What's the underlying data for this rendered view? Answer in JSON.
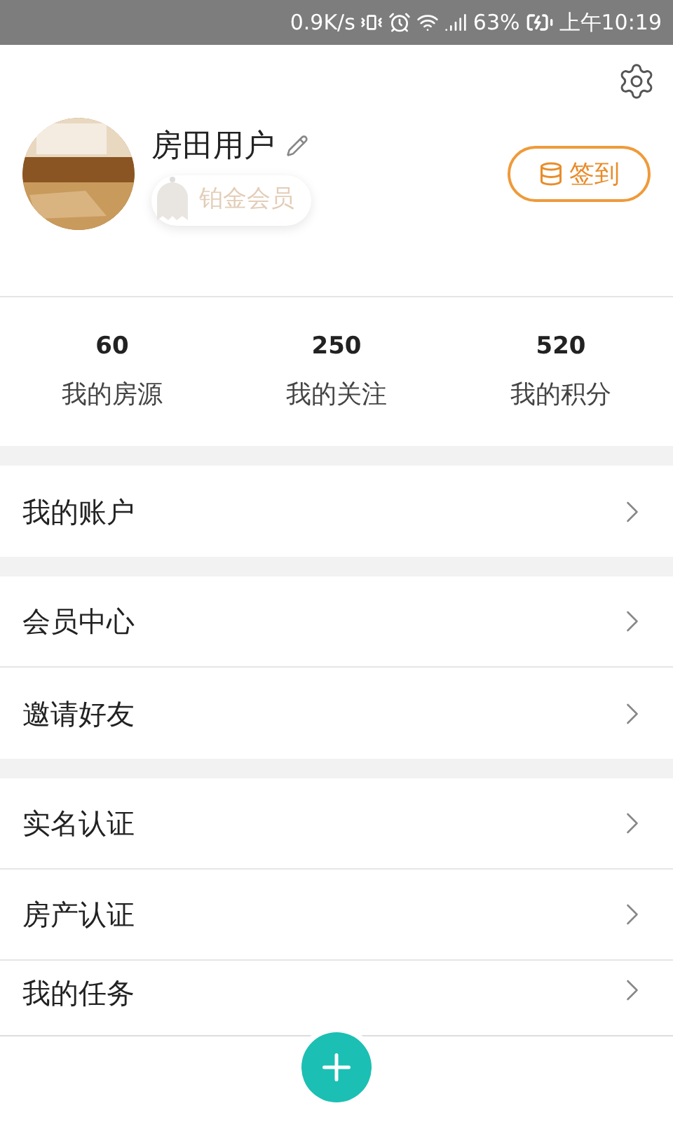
{
  "status_bar": {
    "speed": "0.9K/s",
    "battery": "63%",
    "time": "上午10:19"
  },
  "profile": {
    "name": "房田用户",
    "badge": "铂金会员",
    "checkin": "签到"
  },
  "stats": [
    {
      "value": "60",
      "label": "我的房源"
    },
    {
      "value": "250",
      "label": "我的关注"
    },
    {
      "value": "520",
      "label": "我的积分"
    }
  ],
  "menu_groups": [
    [
      "我的账户"
    ],
    [
      "会员中心",
      "邀请好友"
    ],
    [
      "实名认证",
      "房产认证",
      "我的任务"
    ]
  ]
}
